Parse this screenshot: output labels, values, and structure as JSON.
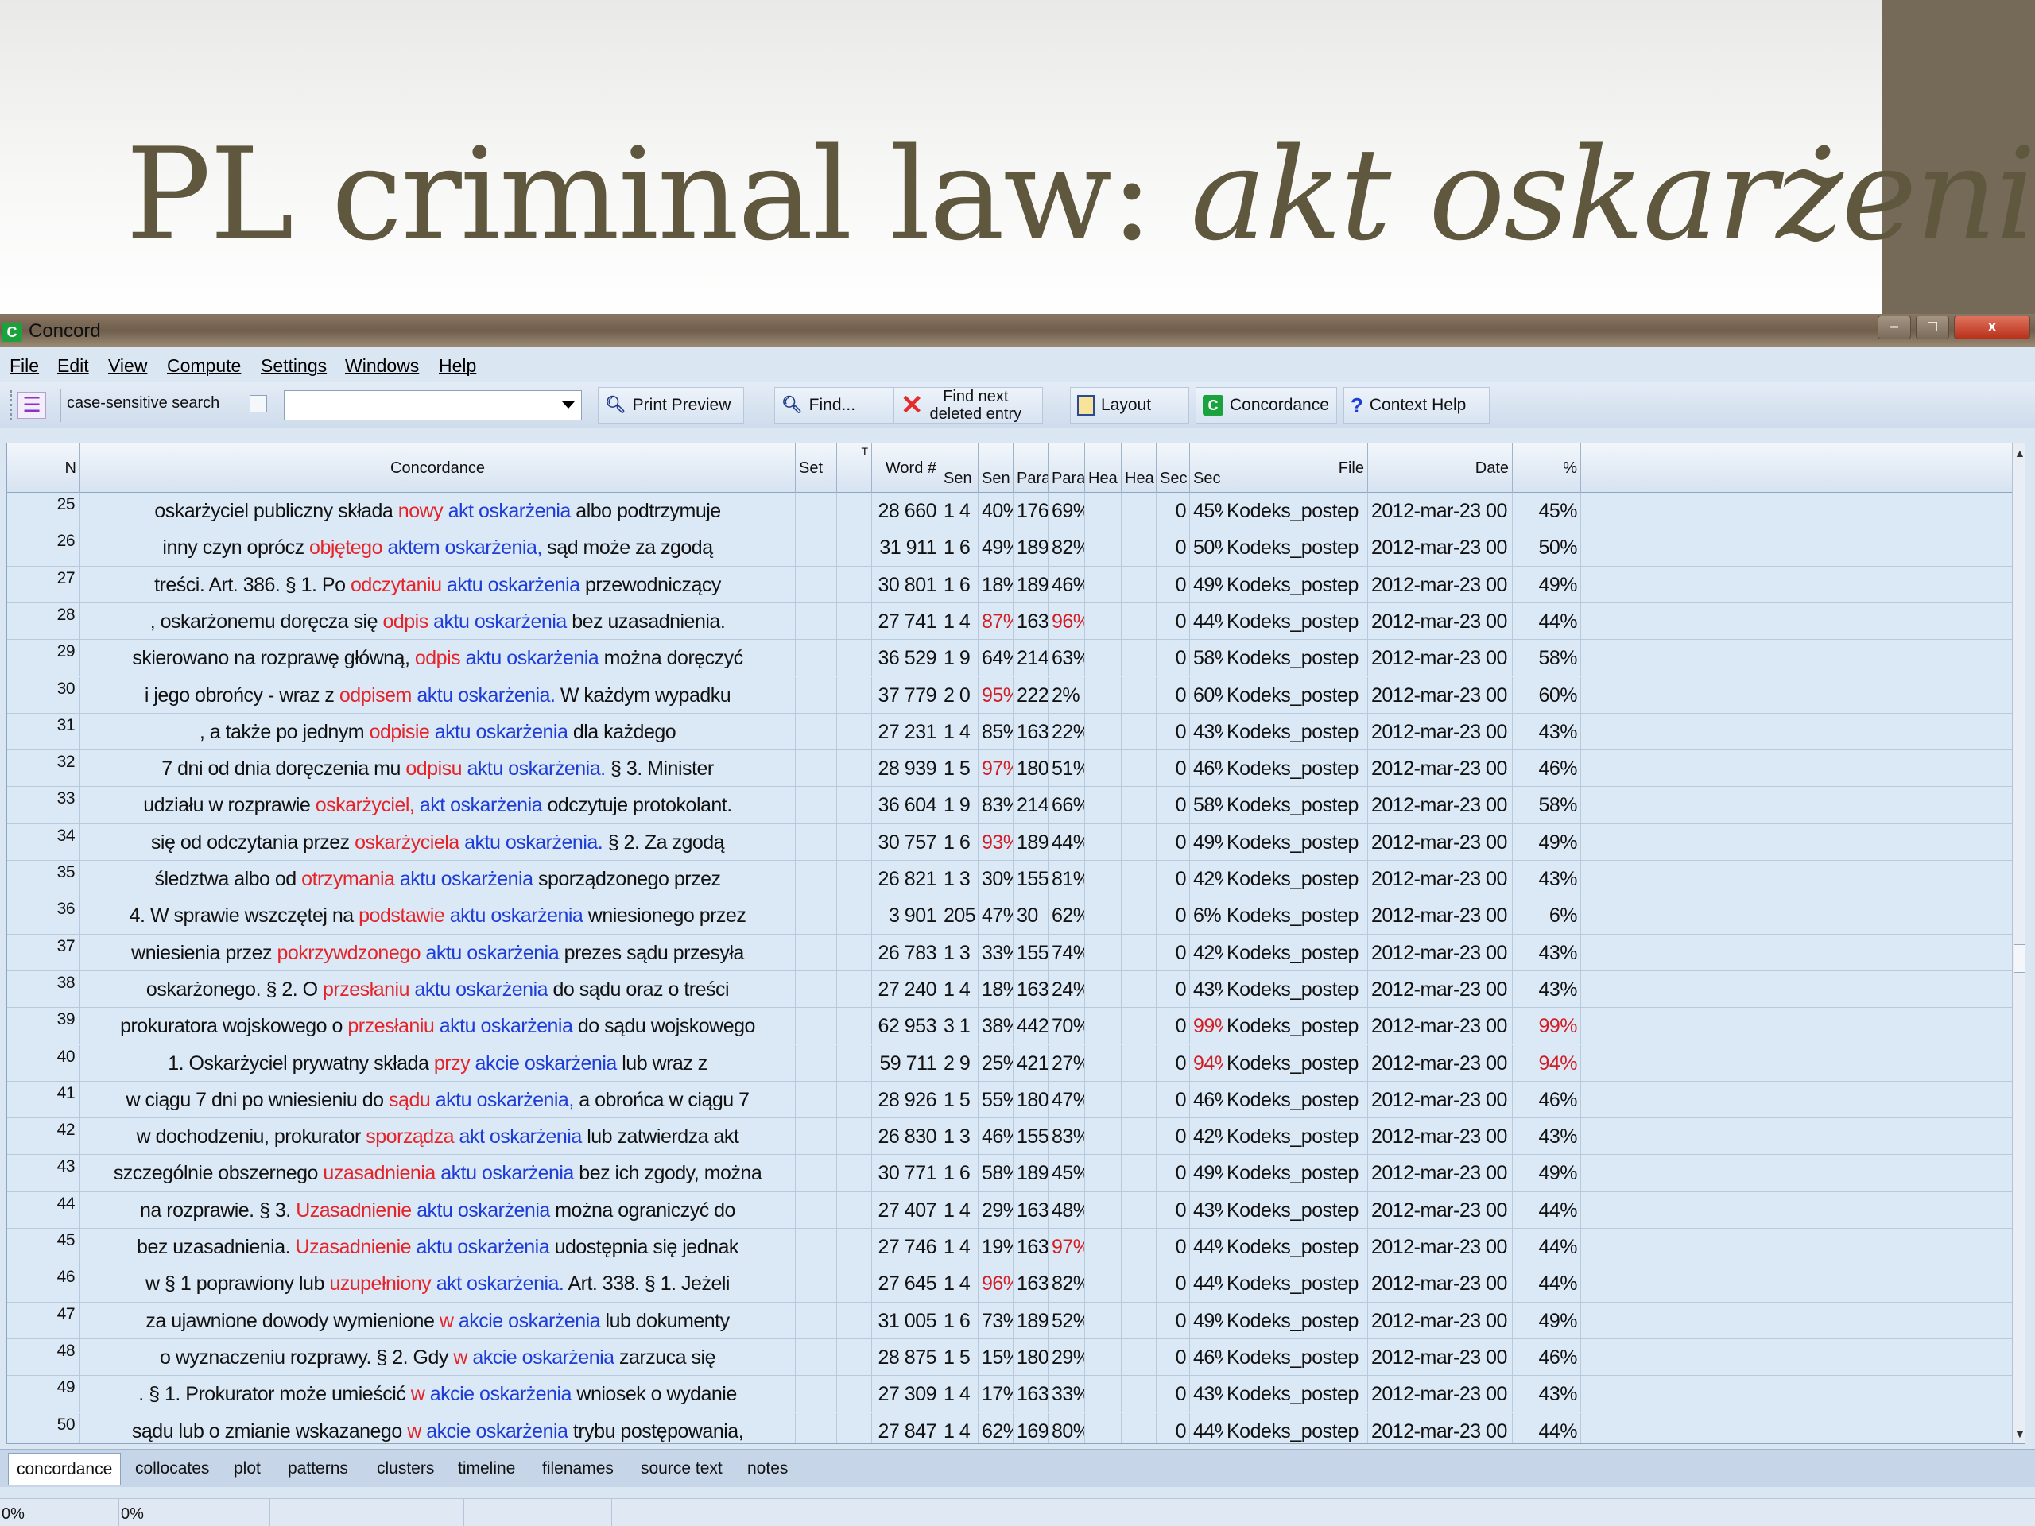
{
  "slide": {
    "title_plain": "PL criminal law: ",
    "title_italic": "akt oskarżenia"
  },
  "window": {
    "title": "Concord",
    "app_icon": "C",
    "minimize": "–",
    "maximize": "□",
    "close": "x"
  },
  "menu": [
    "File",
    "Edit",
    "View",
    "Compute",
    "Settings",
    "Windows",
    "Help"
  ],
  "toolbar": {
    "case_sensitive": "case-sensitive search",
    "search_value": "",
    "print_preview": "Print Preview",
    "find": "Find...",
    "find_next_line1": "Find next",
    "find_next_line2": "deleted entry",
    "layout": "Layout",
    "concordance": "Concordance",
    "context_help": "Context Help"
  },
  "columns": [
    "N",
    "Concordance",
    "Set",
    "T",
    "Word #",
    "Sen",
    "Sen",
    "Para",
    "Para",
    "Hea",
    "Hea",
    "Sec",
    "Sec",
    "File",
    "Date",
    "%"
  ],
  "rows": [
    {
      "n": "25",
      "left": "oskarżyciel publiczny składa",
      "kw1": "nowy",
      "kw2": "akt",
      "kw3": "oskarżenia",
      "right": "albo podtrzymuje",
      "word": "28 660",
      "sen1": "1 4",
      "sen2": "40%",
      "para1": "176",
      "para2": "69%",
      "sec1": "0",
      "sec2": "45%",
      "sec2_red": false,
      "file": "Kodeks_postep",
      "date": "2012-mar-23 00",
      "pct": "45%",
      "pct_red": false,
      "sen2_red": false,
      "para2_red": false
    },
    {
      "n": "26",
      "left": "inny czyn oprócz",
      "kw1": "objętego",
      "kw2": "aktem",
      "kw3": "oskarżenia,",
      "right": "sąd może za zgodą",
      "word": "31 911",
      "sen1": "1 6",
      "sen2": "49%",
      "para1": "189",
      "para2": "82%",
      "sec1": "0",
      "sec2": "50%",
      "sec2_red": false,
      "file": "Kodeks_postep",
      "date": "2012-mar-23 00",
      "pct": "50%",
      "pct_red": false,
      "sen2_red": false,
      "para2_red": false
    },
    {
      "n": "27",
      "left": "treści. Art. 386. § 1. Po",
      "kw1": "odczytaniu",
      "kw2": "aktu",
      "kw3": "oskarżenia",
      "right": "przewodniczący",
      "word": "30 801",
      "sen1": "1 6",
      "sen2": "18%",
      "para1": "189",
      "para2": "46%",
      "sec1": "0",
      "sec2": "49%",
      "sec2_red": false,
      "file": "Kodeks_postep",
      "date": "2012-mar-23 00",
      "pct": "49%",
      "pct_red": false,
      "sen2_red": false,
      "para2_red": false
    },
    {
      "n": "28",
      "left": ", oskarżonemu doręcza się",
      "kw1": "odpis",
      "kw2": "aktu",
      "kw3": "oskarżenia",
      "right": "bez uzasadnienia.",
      "word": "27 741",
      "sen1": "1 4",
      "sen2": "87%",
      "para1": "163",
      "para2": "96%",
      "sec1": "0",
      "sec2": "44%",
      "sec2_red": false,
      "file": "Kodeks_postep",
      "date": "2012-mar-23 00",
      "pct": "44%",
      "pct_red": false,
      "sen2_red": true,
      "para2_red": true
    },
    {
      "n": "29",
      "left": "skierowano na rozprawę główną,",
      "kw1": "odpis",
      "kw2": "aktu",
      "kw3": "oskarżenia",
      "right": "można doręczyć",
      "word": "36 529",
      "sen1": "1 9",
      "sen2": "64%",
      "para1": "214",
      "para2": "63%",
      "sec1": "0",
      "sec2": "58%",
      "sec2_red": false,
      "file": "Kodeks_postep",
      "date": "2012-mar-23 00",
      "pct": "58%",
      "pct_red": false,
      "sen2_red": false,
      "para2_red": false
    },
    {
      "n": "30",
      "left": "i jego obrońcy - wraz z",
      "kw1": "odpisem",
      "kw2": "aktu",
      "kw3": "oskarżenia.",
      "right": "W każdym wypadku",
      "word": "37 779",
      "sen1": "2 0",
      "sen2": "95%",
      "para1": "222",
      "para2": "2%",
      "sec1": "0",
      "sec2": "60%",
      "sec2_red": false,
      "file": "Kodeks_postep",
      "date": "2012-mar-23 00",
      "pct": "60%",
      "pct_red": false,
      "sen2_red": true,
      "para2_red": false
    },
    {
      "n": "31",
      "left": ", a także po jednym",
      "kw1": "odpisie",
      "kw2": "aktu",
      "kw3": "oskarżenia",
      "right": "dla każdego",
      "word": "27 231",
      "sen1": "1 4",
      "sen2": "85%",
      "para1": "163",
      "para2": "22%",
      "sec1": "0",
      "sec2": "43%",
      "sec2_red": false,
      "file": "Kodeks_postep",
      "date": "2012-mar-23 00",
      "pct": "43%",
      "pct_red": false,
      "sen2_red": false,
      "para2_red": false
    },
    {
      "n": "32",
      "left": "7 dni od dnia doręczenia mu",
      "kw1": "odpisu",
      "kw2": "aktu",
      "kw3": "oskarżenia.",
      "right": "§ 3.  Minister",
      "word": "28 939",
      "sen1": "1 5",
      "sen2": "97%",
      "para1": "180",
      "para2": "51%",
      "sec1": "0",
      "sec2": "46%",
      "sec2_red": false,
      "file": "Kodeks_postep",
      "date": "2012-mar-23 00",
      "pct": "46%",
      "pct_red": false,
      "sen2_red": true,
      "para2_red": false
    },
    {
      "n": "33",
      "left": "udziału w rozprawie",
      "kw1": "oskarżyciel,",
      "kw2": "akt",
      "kw3": "oskarżenia",
      "right": "odczytuje protokolant.",
      "word": "36 604",
      "sen1": "1 9",
      "sen2": "83%",
      "para1": "214",
      "para2": "66%",
      "sec1": "0",
      "sec2": "58%",
      "sec2_red": false,
      "file": "Kodeks_postep",
      "date": "2012-mar-23 00",
      "pct": "58%",
      "pct_red": false,
      "sen2_red": false,
      "para2_red": false
    },
    {
      "n": "34",
      "left": "się od odczytania przez",
      "kw1": "oskarżyciela",
      "kw2": "aktu",
      "kw3": "oskarżenia.",
      "right": "§ 2.  Za zgodą",
      "word": "30 757",
      "sen1": "1 6",
      "sen2": "93%",
      "para1": "189",
      "para2": "44%",
      "sec1": "0",
      "sec2": "49%",
      "sec2_red": false,
      "file": "Kodeks_postep",
      "date": "2012-mar-23 00",
      "pct": "49%",
      "pct_red": false,
      "sen2_red": true,
      "para2_red": false
    },
    {
      "n": "35",
      "left": "śledztwa albo od",
      "kw1": "otrzymania",
      "kw2": "aktu",
      "kw3": "oskarżenia",
      "right": "sporządzonego przez",
      "word": "26 821",
      "sen1": "1 3",
      "sen2": "30%",
      "para1": "155",
      "para2": "81%",
      "sec1": "0",
      "sec2": "42%",
      "sec2_red": false,
      "file": "Kodeks_postep",
      "date": "2012-mar-23 00",
      "pct": "43%",
      "pct_red": false,
      "sen2_red": false,
      "para2_red": false
    },
    {
      "n": "36",
      "left": "4. W sprawie wszczętej na",
      "kw1": "podstawie",
      "kw2": "aktu",
      "kw3": "oskarżenia",
      "right": "wniesionego przez",
      "word": "3 901",
      "sen1": "205",
      "sen2": "47%",
      "para1": "30",
      "para2": "62%",
      "sec1": "0",
      "sec2": "6%",
      "sec2_red": false,
      "file": "Kodeks_postep",
      "date": "2012-mar-23 00",
      "pct": "6%",
      "pct_red": false,
      "sen2_red": false,
      "para2_red": false
    },
    {
      "n": "37",
      "left": "wniesienia przez",
      "kw1": "pokrzywdzonego",
      "kw2": "aktu",
      "kw3": "oskarżenia",
      "right": "prezes sądu przesyła",
      "word": "26 783",
      "sen1": "1 3",
      "sen2": "33%",
      "para1": "155",
      "para2": "74%",
      "sec1": "0",
      "sec2": "42%",
      "sec2_red": false,
      "file": "Kodeks_postep",
      "date": "2012-mar-23 00",
      "pct": "43%",
      "pct_red": false,
      "sen2_red": false,
      "para2_red": false
    },
    {
      "n": "38",
      "left": "oskarżonego. § 2.  O",
      "kw1": "przesłaniu",
      "kw2": "aktu",
      "kw3": "oskarżenia",
      "right": "do sądu oraz o treści",
      "word": "27 240",
      "sen1": "1 4",
      "sen2": "18%",
      "para1": "163",
      "para2": "24%",
      "sec1": "0",
      "sec2": "43%",
      "sec2_red": false,
      "file": "Kodeks_postep",
      "date": "2012-mar-23 00",
      "pct": "43%",
      "pct_red": false,
      "sen2_red": false,
      "para2_red": false
    },
    {
      "n": "39",
      "left": "prokuratora wojskowego o",
      "kw1": "przesłaniu",
      "kw2": "aktu",
      "kw3": "oskarżenia",
      "right": "do sądu wojskowego",
      "word": "62 953",
      "sen1": "3 1",
      "sen2": "38%",
      "para1": "442",
      "para2": "70%",
      "sec1": "0",
      "sec2": "99%",
      "sec2_red": true,
      "file": "Kodeks_postep",
      "date": "2012-mar-23 00",
      "pct": "99%",
      "pct_red": true,
      "sen2_red": false,
      "para2_red": false
    },
    {
      "n": "40",
      "left": "1. Oskarżyciel prywatny składa",
      "kw1": "przy",
      "kw2": "akcie",
      "kw3": "oskarżenia",
      "right": "lub wraz z",
      "word": "59 711",
      "sen1": "2 9",
      "sen2": "25%",
      "para1": "421",
      "para2": "27%",
      "sec1": "0",
      "sec2": "94%",
      "sec2_red": true,
      "file": "Kodeks_postep",
      "date": "2012-mar-23 00",
      "pct": "94%",
      "pct_red": true,
      "sen2_red": false,
      "para2_red": false
    },
    {
      "n": "41",
      "left": "w ciągu 7 dni po wniesieniu do",
      "kw1": "sądu",
      "kw2": "aktu",
      "kw3": "oskarżenia,",
      "right": "a obrońca w ciągu 7",
      "word": "28 926",
      "sen1": "1 5",
      "sen2": "55%",
      "para1": "180",
      "para2": "47%",
      "sec1": "0",
      "sec2": "46%",
      "sec2_red": false,
      "file": "Kodeks_postep",
      "date": "2012-mar-23 00",
      "pct": "46%",
      "pct_red": false,
      "sen2_red": false,
      "para2_red": false
    },
    {
      "n": "42",
      "left": "w dochodzeniu, prokurator",
      "kw1": "sporządza",
      "kw2": "akt",
      "kw3": "oskarżenia",
      "right": "lub zatwierdza akt",
      "word": "26 830",
      "sen1": "1 3",
      "sen2": "46%",
      "para1": "155",
      "para2": "83%",
      "sec1": "0",
      "sec2": "42%",
      "sec2_red": false,
      "file": "Kodeks_postep",
      "date": "2012-mar-23 00",
      "pct": "43%",
      "pct_red": false,
      "sen2_red": false,
      "para2_red": false
    },
    {
      "n": "43",
      "left": "szczególnie obszernego",
      "kw1": "uzasadnienia",
      "kw2": "aktu",
      "kw3": "oskarżenia",
      "right": "bez ich zgody, można",
      "word": "30 771",
      "sen1": "1 6",
      "sen2": "58%",
      "para1": "189",
      "para2": "45%",
      "sec1": "0",
      "sec2": "49%",
      "sec2_red": false,
      "file": "Kodeks_postep",
      "date": "2012-mar-23 00",
      "pct": "49%",
      "pct_red": false,
      "sen2_red": false,
      "para2_red": false
    },
    {
      "n": "44",
      "left": "na rozprawie. § 3.",
      "kw1": "Uzasadnienie",
      "kw2": "aktu",
      "kw3": "oskarżenia",
      "right": "można ograniczyć do",
      "word": "27 407",
      "sen1": "1 4",
      "sen2": "29%",
      "para1": "163",
      "para2": "48%",
      "sec1": "0",
      "sec2": "43%",
      "sec2_red": false,
      "file": "Kodeks_postep",
      "date": "2012-mar-23 00",
      "pct": "44%",
      "pct_red": false,
      "sen2_red": false,
      "para2_red": false
    },
    {
      "n": "45",
      "left": "bez uzasadnienia.",
      "kw1": "Uzasadnienie",
      "kw2": "aktu",
      "kw3": "oskarżenia",
      "right": "udostępnia się jednak",
      "word": "27 746",
      "sen1": "1 4",
      "sen2": "19%",
      "para1": "163",
      "para2": "97%",
      "sec1": "0",
      "sec2": "44%",
      "sec2_red": false,
      "file": "Kodeks_postep",
      "date": "2012-mar-23 00",
      "pct": "44%",
      "pct_red": false,
      "sen2_red": false,
      "para2_red": true
    },
    {
      "n": "46",
      "left": "w § 1 poprawiony lub",
      "kw1": "uzupełniony",
      "kw2": "akt",
      "kw3": "oskarżenia.",
      "right": "Art. 338. § 1.  Jeżeli",
      "word": "27 645",
      "sen1": "1 4",
      "sen2": "96%",
      "para1": "163",
      "para2": "82%",
      "sec1": "0",
      "sec2": "44%",
      "sec2_red": false,
      "file": "Kodeks_postep",
      "date": "2012-mar-23 00",
      "pct": "44%",
      "pct_red": false,
      "sen2_red": true,
      "para2_red": false
    },
    {
      "n": "47",
      "left": "za ujawnione dowody wymienione",
      "kw1": "w",
      "kw2": "akcie",
      "kw3": "oskarżenia",
      "right": "lub dokumenty",
      "word": "31 005",
      "sen1": "1 6",
      "sen2": "73%",
      "para1": "189",
      "para2": "52%",
      "sec1": "0",
      "sec2": "49%",
      "sec2_red": false,
      "file": "Kodeks_postep",
      "date": "2012-mar-23 00",
      "pct": "49%",
      "pct_red": false,
      "sen2_red": false,
      "para2_red": false
    },
    {
      "n": "48",
      "left": "o wyznaczeniu rozprawy. § 2. Gdy",
      "kw1": "w",
      "kw2": "akcie",
      "kw3": "oskarżenia",
      "right": "zarzuca się",
      "word": "28 875",
      "sen1": "1 5",
      "sen2": "15%",
      "para1": "180",
      "para2": "29%",
      "sec1": "0",
      "sec2": "46%",
      "sec2_red": false,
      "file": "Kodeks_postep",
      "date": "2012-mar-23 00",
      "pct": "46%",
      "pct_red": false,
      "sen2_red": false,
      "para2_red": false
    },
    {
      "n": "49",
      "left": ". § 1. Prokurator może umieścić",
      "kw1": "w",
      "kw2": "akcie",
      "kw3": "oskarżenia",
      "right": "wniosek o wydanie",
      "word": "27 309",
      "sen1": "1 4",
      "sen2": "17%",
      "para1": "163",
      "para2": "33%",
      "sec1": "0",
      "sec2": "43%",
      "sec2_red": false,
      "file": "Kodeks_postep",
      "date": "2012-mar-23 00",
      "pct": "43%",
      "pct_red": false,
      "sen2_red": false,
      "para2_red": false
    },
    {
      "n": "50",
      "left": "sądu lub o zmianie wskazanego",
      "kw1": "w",
      "kw2": "akcie",
      "kw3": "oskarżenia",
      "right": "trybu postępowania,",
      "word": "27 847",
      "sen1": "1 4",
      "sen2": "62%",
      "para1": "169",
      "para2": "80%",
      "sec1": "0",
      "sec2": "44%",
      "sec2_red": false,
      "file": "Kodeks_postep",
      "date": "2012-mar-23 00",
      "pct": "44%",
      "pct_red": false,
      "sen2_red": false,
      "para2_red": false
    }
  ],
  "tabs": [
    "concordance",
    "collocates",
    "plot",
    "patterns",
    "clusters",
    "timeline",
    "filenames",
    "source text",
    "notes"
  ],
  "status": [
    "0%",
    "0%"
  ]
}
